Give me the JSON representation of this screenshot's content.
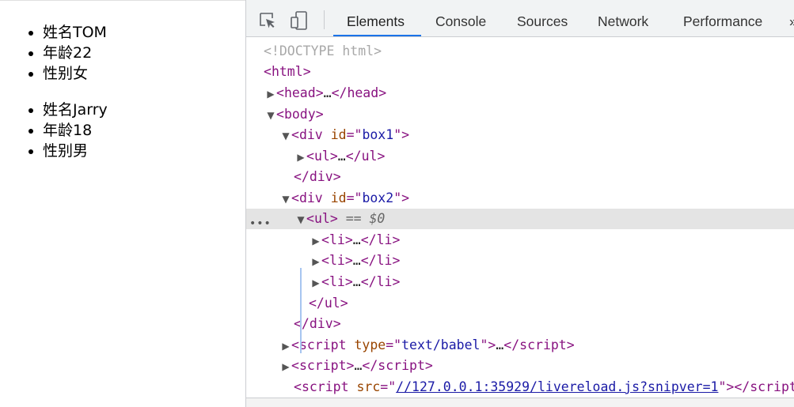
{
  "preview": {
    "list1": [
      "姓名TOM",
      "年龄22",
      "性别女"
    ],
    "list2": [
      "姓名Jarry",
      "年龄18",
      "性别男"
    ]
  },
  "devtools": {
    "tabs": {
      "elements": "Elements",
      "console": "Console",
      "sources": "Sources",
      "network": "Network",
      "performance": "Performance",
      "more": "»"
    },
    "icons": {
      "inspect": "inspect-element-icon",
      "device": "device-toolbar-icon"
    },
    "accent": "#1a73e8",
    "tree": {
      "doctype": "<!DOCTYPE html>",
      "html": "html",
      "head": "head",
      "body": "body",
      "div": "div",
      "ul": "ul",
      "li": "li",
      "script": "script",
      "id_attr": "id",
      "box1": "box1",
      "box2": "box2",
      "selected_marker": "== $0",
      "type_attr": "type",
      "type_value": "text/babel",
      "src_attr": "src",
      "src_value": "//127.0.0.1:35929/livereload.js?snipver=1",
      "ellipsis": "…",
      "row_dots": "•••"
    }
  }
}
